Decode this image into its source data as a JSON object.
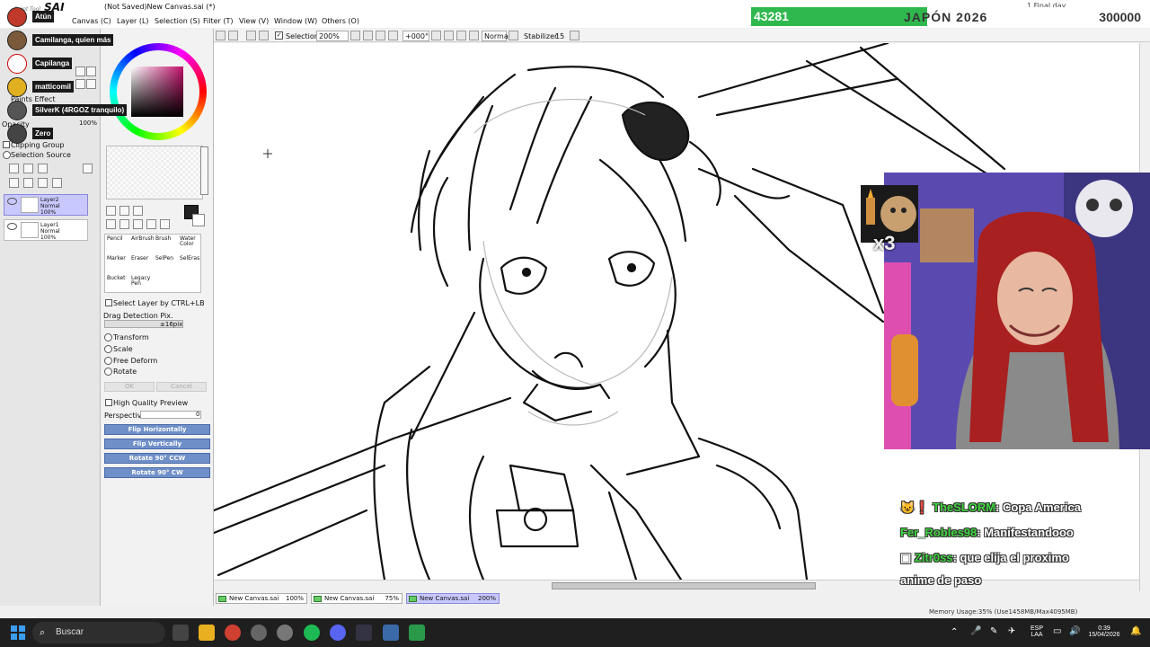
{
  "app": {
    "logo": "SAI",
    "logo_small": "Paint Tool",
    "doc_title": "(Not Saved)New Canvas.sai (*)",
    "time_label": "1 Final day"
  },
  "menu": [
    "Canvas (C)",
    "Layer (L)",
    "Selection (S)",
    "Filter (T)",
    "View (V)",
    "Window (W)",
    "Others (O)"
  ],
  "toolbar": {
    "selection_label": "Selection",
    "zoom": "200%",
    "rotation": "+000°",
    "blend_mode": "Normal",
    "stabilizer_label": "Stabilizer",
    "stabilizer_value": "15"
  },
  "counter": {
    "current": "43281",
    "goal_name": "JAPÓN 2026",
    "goal": "300000"
  },
  "viewers": [
    "Atún",
    "Camilanga, quien más",
    "Capilanga",
    "matticomil",
    "SilverK (4RGOZ tranquilo)",
    "Zero"
  ],
  "left_panel": {
    "effect_label": "Paints Effect",
    "opacity_label": "Opacity",
    "opacity_value": "100%",
    "clipping_label": "Clipping Group",
    "selection_source_label": "Selection Source",
    "layers": [
      {
        "name": "Layer2",
        "mode": "Normal",
        "opacity": "100%"
      },
      {
        "name": "Layer1",
        "mode": "Normal",
        "opacity": "100%"
      }
    ]
  },
  "tools": [
    "Pencil",
    "AirBrush",
    "Brush",
    "Water Color",
    "Marker",
    "Eraser",
    "SelPen",
    "SelEras",
    "Bucket",
    "Legacy Pen"
  ],
  "transform_panel": {
    "select_layer_label": "Select Layer by CTRL+LB",
    "drag_detection_label": "Drag Detection Pix.",
    "drag_value": "±16pix",
    "options": [
      "Transform",
      "Scale",
      "Free Deform",
      "Rotate"
    ],
    "ok": "OK",
    "cancel": "Cancel",
    "hq_label": "High Quality Preview",
    "perspective_label": "Perspective",
    "perspective_value": "0",
    "buttons": [
      "Flip Horizontally",
      "Flip Vertically",
      "Rotate 90° CCW",
      "Rotate 90° CW"
    ]
  },
  "doc_tabs": [
    {
      "name": "New Canvas.sai",
      "zoom": "100%"
    },
    {
      "name": "New Canvas.sai",
      "zoom": "75%"
    },
    {
      "name": "New Canvas.sai",
      "zoom": "200%"
    }
  ],
  "memory": "Memory Usage:35% (Use1458MB/Max4095MB)",
  "sticker_text": "x3",
  "chat": [
    {
      "name": "TheSLORM",
      "message": ": Copa America"
    },
    {
      "name": "Fer_Robles98",
      "message": ": Manifestandooo"
    },
    {
      "name": "Zitr0ss",
      "message": ": que elija el proximo"
    },
    {
      "name": "",
      "message": "anime de paso"
    }
  ],
  "taskbar": {
    "search": "Buscar",
    "lang_top": "ESP",
    "lang_bottom": "LAA",
    "time": "0:39",
    "date": "15/04/2026"
  },
  "colors": {
    "counter_green": "#2fb84e",
    "chat_name": "#3fd43f",
    "layer_selected": "#c8c8ff",
    "blue_button": "#6f8fc8"
  }
}
